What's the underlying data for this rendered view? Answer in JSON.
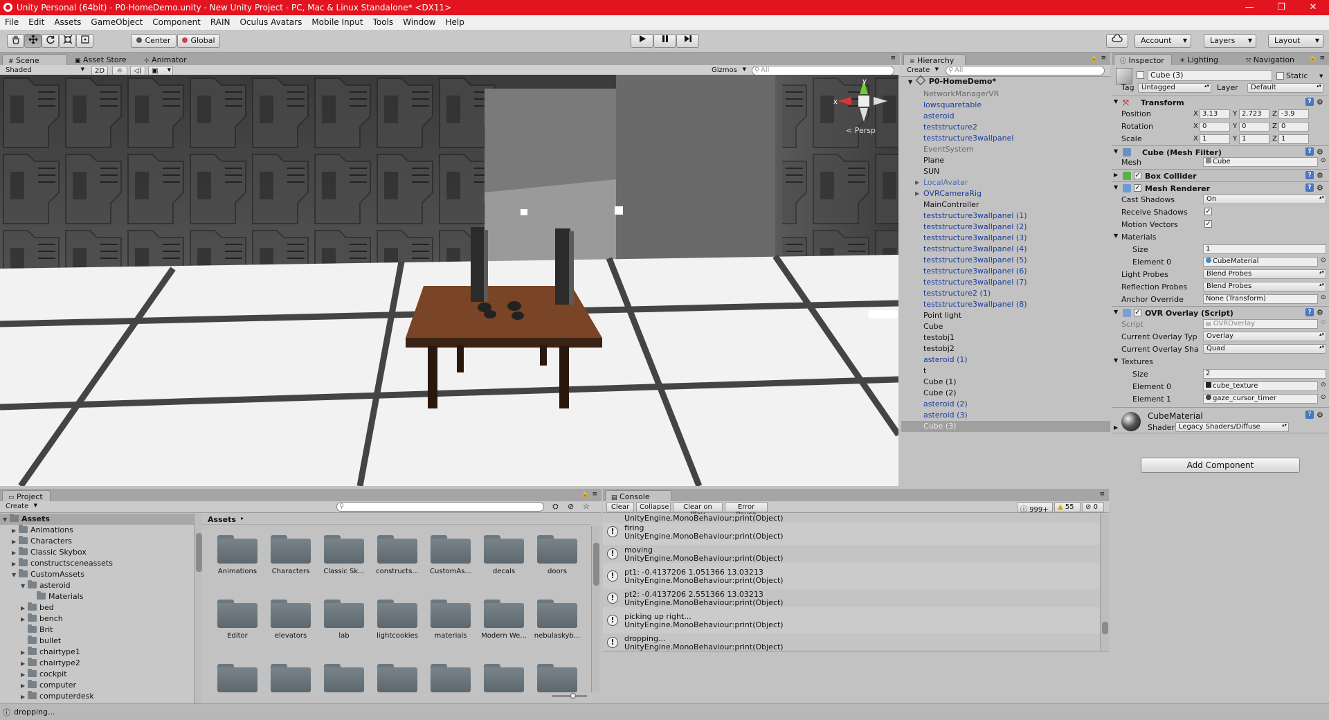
{
  "window": {
    "title": "Unity Personal (64bit) - P0-HomeDemo.unity - New Unity Project - PC, Mac & Linux Standalone* <DX11>",
    "controls": [
      "—",
      "❐",
      "✕"
    ]
  },
  "menu": [
    "File",
    "Edit",
    "Assets",
    "GameObject",
    "Component",
    "RAIN",
    "Oculus Avatars",
    "Mobile Input",
    "Tools",
    "Window",
    "Help"
  ],
  "toolbar": {
    "pivot": "Center",
    "space": "Global",
    "account": "Account",
    "layers": "Layers",
    "layout": "Layout"
  },
  "scene_tabs": [
    "Scene",
    "Asset Store",
    "Animator"
  ],
  "scene_bar": {
    "shading": "Shaded",
    "mode2d": "2D",
    "gizmos": "Gizmos",
    "search_placeholder": "All"
  },
  "scene": {
    "persp_label": "< Persp",
    "gizmo_y": "y",
    "gizmo_x": "x"
  },
  "hierarchy": {
    "tab": "Hierarchy",
    "create": "Create",
    "search_placeholder": "All",
    "scene_name": "P0-HomeDemo*",
    "items": [
      {
        "name": "NetworkManagerVR",
        "style": "dis"
      },
      {
        "name": "lowsquaretable",
        "style": "prefab"
      },
      {
        "name": "asteroid",
        "style": "prefab"
      },
      {
        "name": "teststructure2",
        "style": "prefab"
      },
      {
        "name": "teststructure3wallpanel",
        "style": "prefab"
      },
      {
        "name": "EventSystem",
        "style": "dis"
      },
      {
        "name": "Plane",
        "style": ""
      },
      {
        "name": "SUN",
        "style": ""
      },
      {
        "name": "LocalAvatar",
        "style": "pdis",
        "arrow": true
      },
      {
        "name": "OVRCameraRig",
        "style": "prefab",
        "arrow": true
      },
      {
        "name": "MainController",
        "style": ""
      },
      {
        "name": "teststructure3wallpanel (1)",
        "style": "prefab"
      },
      {
        "name": "teststructure3wallpanel (2)",
        "style": "prefab"
      },
      {
        "name": "teststructure3wallpanel (3)",
        "style": "prefab"
      },
      {
        "name": "teststructure3wallpanel (4)",
        "style": "prefab"
      },
      {
        "name": "teststructure3wallpanel (5)",
        "style": "prefab"
      },
      {
        "name": "teststructure3wallpanel (6)",
        "style": "prefab"
      },
      {
        "name": "teststructure3wallpanel (7)",
        "style": "prefab"
      },
      {
        "name": "teststructure2 (1)",
        "style": "prefab"
      },
      {
        "name": "teststructure3wallpanel (8)",
        "style": "prefab"
      },
      {
        "name": "Point light",
        "style": ""
      },
      {
        "name": "Cube",
        "style": ""
      },
      {
        "name": "testobj1",
        "style": ""
      },
      {
        "name": "testobj2",
        "style": ""
      },
      {
        "name": "asteroid (1)",
        "style": "prefab"
      },
      {
        "name": "t",
        "style": ""
      },
      {
        "name": "Cube (1)",
        "style": ""
      },
      {
        "name": "Cube (2)",
        "style": ""
      },
      {
        "name": "asteroid (2)",
        "style": "prefab"
      },
      {
        "name": "asteroid (3)",
        "style": "prefab"
      },
      {
        "name": "Cube (3)",
        "style": "sel"
      }
    ]
  },
  "inspector": {
    "tabs": [
      "Inspector",
      "Lighting",
      "Navigation"
    ],
    "object_name": "Cube (3)",
    "static_label": "Static",
    "tag_label": "Tag",
    "tag_value": "Untagged",
    "layer_label": "Layer",
    "layer_value": "Default",
    "transform": {
      "title": "Transform",
      "position_label": "Position",
      "position": [
        "3.13",
        "2.723",
        "-3.9"
      ],
      "rotation_label": "Rotation",
      "rotation": [
        "0",
        "0",
        "0"
      ],
      "scale_label": "Scale",
      "scale": [
        "1",
        "1",
        "1"
      ]
    },
    "axis": [
      "X",
      "Y",
      "Z"
    ],
    "mesh_filter": {
      "title": "Cube (Mesh Filter)",
      "mesh_label": "Mesh",
      "mesh_value": "Cube"
    },
    "box_collider": {
      "title": "Box Collider"
    },
    "mesh_renderer": {
      "title": "Mesh Renderer",
      "cast_shadows_label": "Cast Shadows",
      "cast_shadows": "On",
      "receive_shadows_label": "Receive Shadows",
      "motion_vectors_label": "Motion Vectors",
      "materials_label": "Materials",
      "size_label": "Size",
      "size": "1",
      "element0_label": "Element 0",
      "element0": "CubeMaterial",
      "light_probes_label": "Light Probes",
      "light_probes": "Blend Probes",
      "reflection_probes_label": "Reflection Probes",
      "reflection_probes": "Blend Probes",
      "anchor_label": "Anchor Override",
      "anchor": "None (Transform)"
    },
    "ovr_overlay": {
      "title": "OVR Overlay (Script)",
      "script_label": "Script",
      "script": "OVROverlay",
      "overlay_type_label": "Current Overlay Typ",
      "overlay_type": "Overlay",
      "overlay_shape_label": "Current Overlay Sha",
      "overlay_shape": "Quad",
      "textures_label": "Textures",
      "size_label": "Size",
      "size": "2",
      "element0_label": "Element 0",
      "element0": "cube_texture",
      "element1_label": "Element 1",
      "element1": "gaze_cursor_timer"
    },
    "material": {
      "name": "CubeMaterial",
      "shader_label": "Shader",
      "shader": "Legacy Shaders/Diffuse"
    },
    "add_component": "Add Component"
  },
  "project": {
    "tab": "Project",
    "create": "Create",
    "tree": [
      {
        "label": "Assets",
        "level": 0,
        "arrow": "▼",
        "bold": true
      },
      {
        "label": "Animations",
        "level": 1,
        "arrow": "▶"
      },
      {
        "label": "Characters",
        "level": 1,
        "arrow": "▶"
      },
      {
        "label": "Classic Skybox",
        "level": 1,
        "arrow": "▶"
      },
      {
        "label": "constructsceneassets",
        "level": 1,
        "arrow": "▶"
      },
      {
        "label": "CustomAssets",
        "level": 1,
        "arrow": "▼"
      },
      {
        "label": "asteroid",
        "level": 2,
        "arrow": "▼"
      },
      {
        "label": "Materials",
        "level": 3,
        "arrow": ""
      },
      {
        "label": "bed",
        "level": 2,
        "arrow": "▶"
      },
      {
        "label": "bench",
        "level": 2,
        "arrow": "▶"
      },
      {
        "label": "Brit",
        "level": 2,
        "arrow": ""
      },
      {
        "label": "bullet",
        "level": 2,
        "arrow": ""
      },
      {
        "label": "chairtype1",
        "level": 2,
        "arrow": "▶"
      },
      {
        "label": "chairtype2",
        "level": 2,
        "arrow": "▶"
      },
      {
        "label": "cockpit",
        "level": 2,
        "arrow": "▶"
      },
      {
        "label": "computer",
        "level": 2,
        "arrow": "▶"
      },
      {
        "label": "computerdesk",
        "level": 2,
        "arrow": "▶"
      }
    ],
    "breadcrumb": "Assets",
    "grid_row1": [
      "Animations",
      "Characters",
      "Classic Sk...",
      "constructs...",
      "CustomAs...",
      "decals",
      "doors"
    ],
    "grid_row2": [
      "Editor",
      "elevators",
      "lab",
      "lightcookies",
      "materials",
      "Modern We...",
      "nebulaskyb..."
    ]
  },
  "console": {
    "tab": "Console",
    "buttons": [
      "Clear",
      "Collapse",
      "Clear on Play",
      "Error Pause"
    ],
    "counts": {
      "info": "999+",
      "warn": "55",
      "error": "0"
    },
    "top_partial": "UnityEngine.MonoBehaviour:print(Object)",
    "entries": [
      {
        "msg": "firing",
        "trace": "UnityEngine.MonoBehaviour:print(Object)"
      },
      {
        "msg": "moving",
        "trace": "UnityEngine.MonoBehaviour:print(Object)"
      },
      {
        "msg": "pt1: -0.4137206 1.051366 13.03213",
        "trace": "UnityEngine.MonoBehaviour:print(Object)"
      },
      {
        "msg": "pt2: -0.4137206 2.551366 13.03213",
        "trace": "UnityEngine.MonoBehaviour:print(Object)"
      },
      {
        "msg": "picking up right...",
        "trace": "UnityEngine.MonoBehaviour:print(Object)"
      },
      {
        "msg": "dropping...",
        "trace": "UnityEngine.MonoBehaviour:print(Object)"
      }
    ]
  },
  "status": {
    "text": "dropping..."
  }
}
